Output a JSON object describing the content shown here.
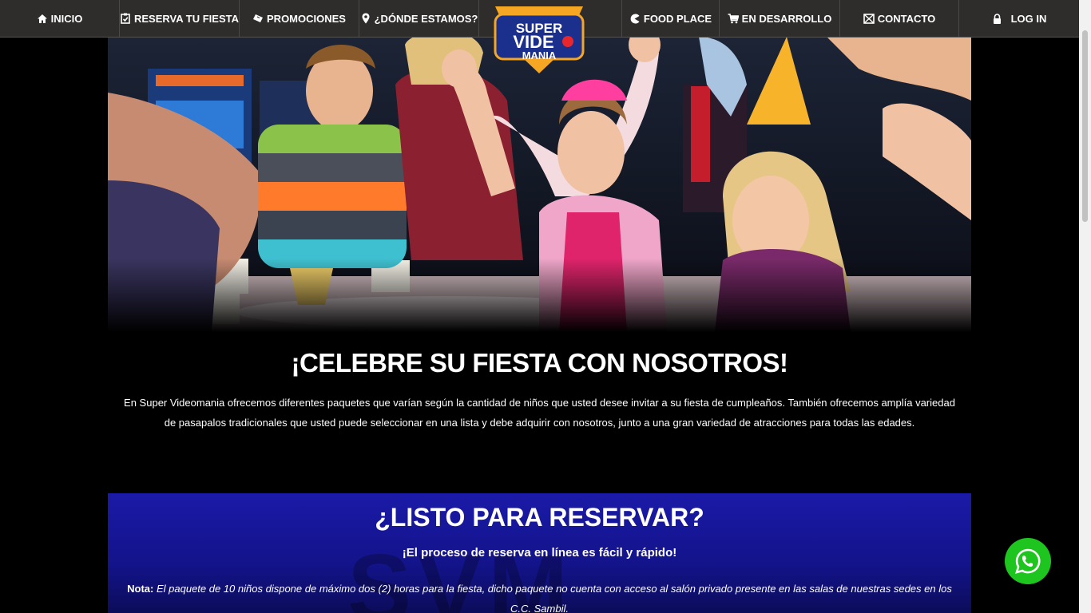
{
  "nav": {
    "inicio": "INICIO",
    "reserva": "RESERVA TU FIESTA",
    "promociones": "PROMOCIONES",
    "donde": "¿DÓNDE ESTAMOS?",
    "food": "FOOD PLACE",
    "desarrollo": "EN DESARROLLO",
    "contacto": "CONTACTO",
    "login": "LOG IN"
  },
  "logo": {
    "line1": "SUPER",
    "line2": "VIDE",
    "line3": "MANIA"
  },
  "intro": {
    "title": "¡CELEBRE SU FIESTA CON NOSOTROS!",
    "text": "En Super Videomania ofrecemos diferentes paquetes que varían según la cantidad de niños que usted desee invitar a su fiesta de cumpleaños. También ofrecemos amplía variedad de pasapalos tradicionales que usted puede seleccionar en una lista y debe adquirir con nosotros, junto a una gran variedad de atracciones para todas las edades."
  },
  "reserve": {
    "title": "¿LISTO PARA RESERVAR?",
    "subtitle": "¡El proceso de reserva en línea es fácil y rápido!",
    "note_label": "Nota:",
    "note_text": "El paquete de 10 niños dispone de máximo dos (2) horas para la fiesta, dicho paquete no cuenta con acceso al salón privado presente en las salas de nuestras sedes en los C.C. Sambil."
  },
  "colors": {
    "navbar": "#2f2d2c",
    "reserve_blue": "#1a1aa8",
    "whatsapp": "#1ec51e",
    "logo_red": "#e8262d",
    "logo_blue": "#1b2f8c"
  },
  "icons": [
    "home-icon",
    "clipboard-check-icon",
    "ticket-icon",
    "map-pin-icon",
    "pacman-icon",
    "cart-icon",
    "envelope-icon",
    "lock-icon",
    "whatsapp-icon"
  ]
}
